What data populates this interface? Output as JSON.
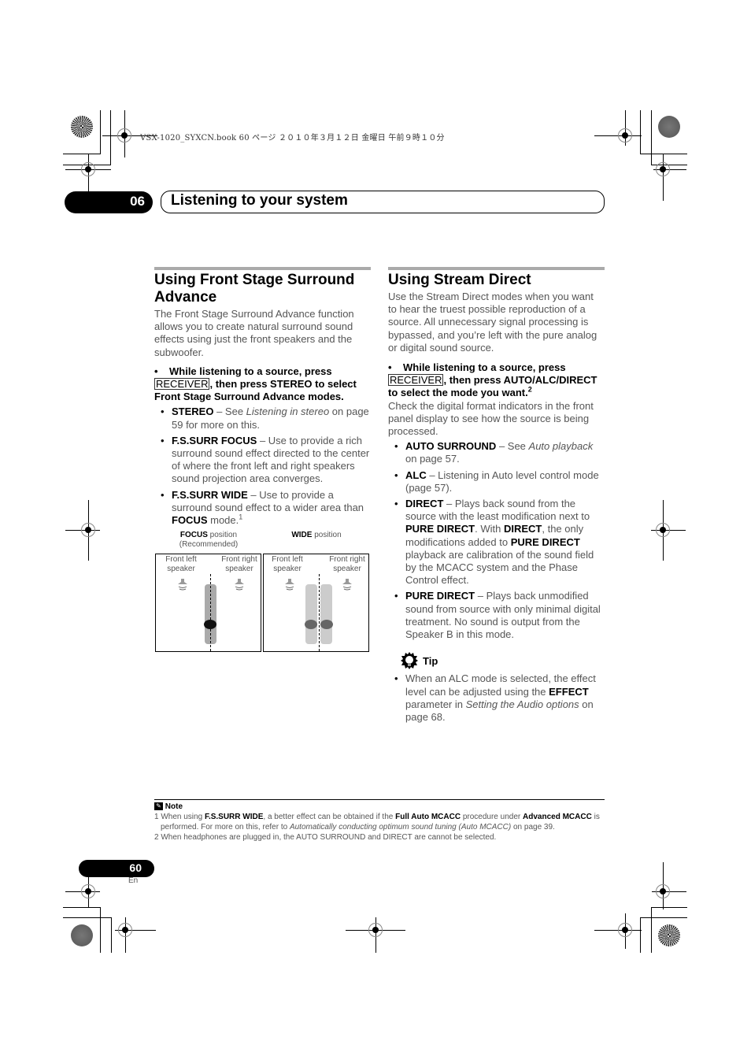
{
  "print_header": {
    "file_info": "VSX-1020_SYXCN.book  60 ページ  ２０１０年３月１２日  金曜日  午前９時１０分"
  },
  "chapter": {
    "number": "06",
    "title": "Listening to your system"
  },
  "left_section": {
    "title": "Using Front Stage Surround Advance",
    "intro": "The Front Stage Surround Advance function allows you to create natural surround sound effects using just the front speakers and the subwoofer.",
    "step": {
      "lead": "While listening to a source, press",
      "key": "RECEIVER",
      "rest": ", then press STEREO to select Front Stage Surround Advance modes."
    },
    "items": [
      {
        "term": "STEREO",
        "sep": " – See ",
        "italic": "Listening in stereo",
        "text": " on page 59 for more on this."
      },
      {
        "term": "F.S.SURR FOCUS",
        "text": " – Use to provide a rich surround sound effect directed to the center of where the front left and right speakers sound projection area converges."
      },
      {
        "term": "F.S.SURR WIDE",
        "text": " – Use to provide a surround sound effect to a wider area than ",
        "term2": "FOCUS",
        "text2": " mode.",
        "footnote": "1"
      }
    ],
    "diagrams": [
      {
        "caption_bold": "FOCUS",
        "caption": " position",
        "caption_sub": "(Recommended)",
        "left_label": "Front left speaker",
        "right_label": "Front right speaker"
      },
      {
        "caption_bold": "WIDE",
        "caption": " position",
        "caption_sub": "",
        "left_label": "Front left speaker",
        "right_label": "Front right speaker"
      }
    ]
  },
  "right_section": {
    "title": "Using Stream Direct",
    "intro": "Use the Stream Direct modes when you want to hear the truest possible reproduction of a source. All unnecessary signal processing is bypassed, and you’re left with the pure analog or digital sound source.",
    "step": {
      "lead": "While listening to a source, press",
      "key": "RECEIVER",
      "rest": ", then press AUTO/ALC/DIRECT to select the mode you want.",
      "footnote": "2"
    },
    "after_step": "Check the digital format indicators in the front panel display to see how the source is being processed.",
    "items": [
      {
        "term": "AUTO SURROUND",
        "sep": " – See ",
        "italic": "Auto playback",
        "text": " on page 57."
      },
      {
        "term": "ALC",
        "text": " – Listening in Auto level control mode (page 57)."
      },
      {
        "term": "DIRECT",
        "text": " – Plays back sound from the source with the least modification next to ",
        "term2": "PURE DIRECT",
        "text2": ". With ",
        "term3": "DIRECT",
        "text3": ", the only modifications added to ",
        "term4": "PURE DIRECT",
        "text4": " playback are calibration of the sound field by the MCACC system and the Phase Control effect."
      },
      {
        "term": "PURE DIRECT",
        "text": " – Plays back unmodified sound from source with only minimal digital treatment. No sound is output from the Speaker B in this mode."
      }
    ],
    "tip": {
      "label": "Tip",
      "text1": "When an ALC mode is selected, the effect level can be adjusted using the ",
      "bold": "EFFECT",
      "text2": " parameter in ",
      "italic": "Setting the Audio options",
      "text3": " on page 68."
    }
  },
  "notes": {
    "label": "Note",
    "items": [
      {
        "num": "1",
        "t1": " When using ",
        "b1": "F.S.SURR WIDE",
        "t2": ", a better effect can be obtained if the ",
        "b2": "Full Auto MCACC",
        "t3": " procedure under ",
        "b3": "Advanced MCACC",
        "t4": " is performed. For more on this, refer to ",
        "i1": "Automatically conducting optimum sound tuning (Auto MCACC)",
        "t5": " on page 39."
      },
      {
        "num": "2",
        "t1": "  When headphones are plugged in, the AUTO SURROUND and DIRECT are cannot be selected."
      }
    ]
  },
  "footer": {
    "page_number": "60",
    "language": "En"
  }
}
